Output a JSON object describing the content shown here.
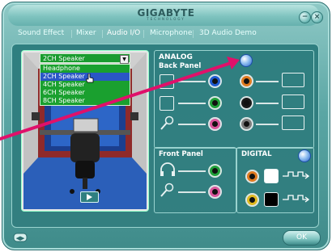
{
  "window": {
    "brand": "GIGABYTE",
    "brand_sub": "TECHNOLOGY",
    "buttons": [
      "minimize",
      "close"
    ]
  },
  "tabs": [
    {
      "label": "Sound Effect",
      "active": false
    },
    {
      "label": "Mixer",
      "active": false
    },
    {
      "label": "Audio I/O",
      "active": true
    },
    {
      "label": "Microphone",
      "active": false
    },
    {
      "label": "3D Audio Demo",
      "active": false
    }
  ],
  "speaker_config": {
    "selected": "2CH Speaker",
    "options": [
      "Headphone",
      "2CH Speaker",
      "4CH Speaker",
      "6CH Speaker",
      "8CH Speaker"
    ],
    "highlighted_index": 1
  },
  "analog": {
    "title": "ANALOG",
    "back_panel_label": "Back Panel",
    "back_jacks": [
      {
        "side": "left",
        "color": "#1f5bd1"
      },
      {
        "side": "left",
        "color": "#21a03a"
      },
      {
        "side": "left",
        "color": "#d9559c"
      },
      {
        "side": "right",
        "color": "#e07a1f"
      },
      {
        "side": "right",
        "color": "#1a1a1a"
      },
      {
        "side": "right",
        "color": "#7b7b7b"
      }
    ]
  },
  "front_panel": {
    "label": "Front Panel",
    "jacks": [
      {
        "type": "headphone-icon",
        "color": "#21a03a"
      },
      {
        "type": "microphone-icon",
        "color": "#d9559c"
      }
    ]
  },
  "digital": {
    "label": "DIGITAL",
    "ports": [
      {
        "type": "coaxial",
        "color": "#e07a1f"
      },
      {
        "type": "optical",
        "color": "#e0b91f"
      }
    ]
  },
  "footer": {
    "ok_label": "OK"
  },
  "colors": {
    "accent": "#3f8b8a",
    "annotation_arrow": "#e0106a",
    "dropdown_bg": "#1a9b2f",
    "selection": "#2a56c6"
  }
}
